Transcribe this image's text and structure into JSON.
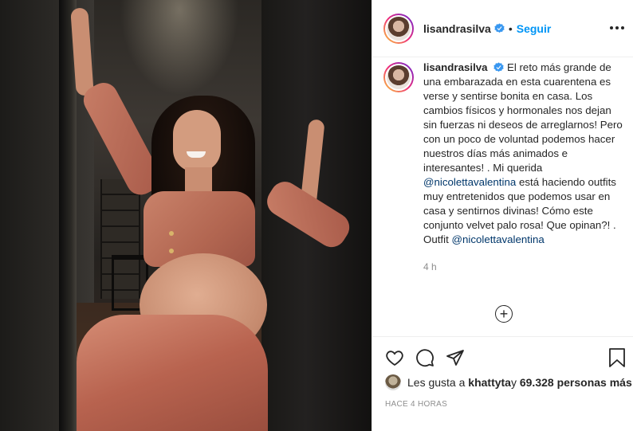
{
  "header": {
    "username": "lisandrasilva",
    "separator": "•",
    "follow_label": "Seguir"
  },
  "caption": {
    "username": "lisandrasilva",
    "text_part1": "El reto más grande de una embarazada en esta cuarentena es verse y sentirse bonita en casa. Los cambios físicos y hormonales nos dejan sin fuerzas ni deseos de arreglarnos! Pero con un poco de voluntad podemos hacer nuestros días más animados e interesantes! . Mi querida ",
    "mention1": "@nicolettavalentina",
    "text_part2": " está haciendo outfits muy entretenidos que podemos usar en casa y sentirnos divinas! Cómo este conjunto velvet palo rosa! Que opinan?! . Outfit ",
    "mention2": "@nicolettavalentina",
    "time": "4 h"
  },
  "load_more_symbol": "+",
  "likes": {
    "prefix": "Les gusta a ",
    "user": "khattyta",
    "middle": " y ",
    "count": "69.328 personas más"
  },
  "timestamp": "HACE 4 HORAS",
  "icons": {
    "verified": "verified-badge-icon",
    "like": "heart-icon",
    "comment": "comment-icon",
    "share": "share-icon",
    "save": "bookmark-icon",
    "more": "more-options-icon",
    "load_more": "plus-circle-icon"
  },
  "colors": {
    "accent": "#0095f6",
    "mention": "#00376b",
    "muted": "#8e8e8e",
    "text": "#262626"
  }
}
